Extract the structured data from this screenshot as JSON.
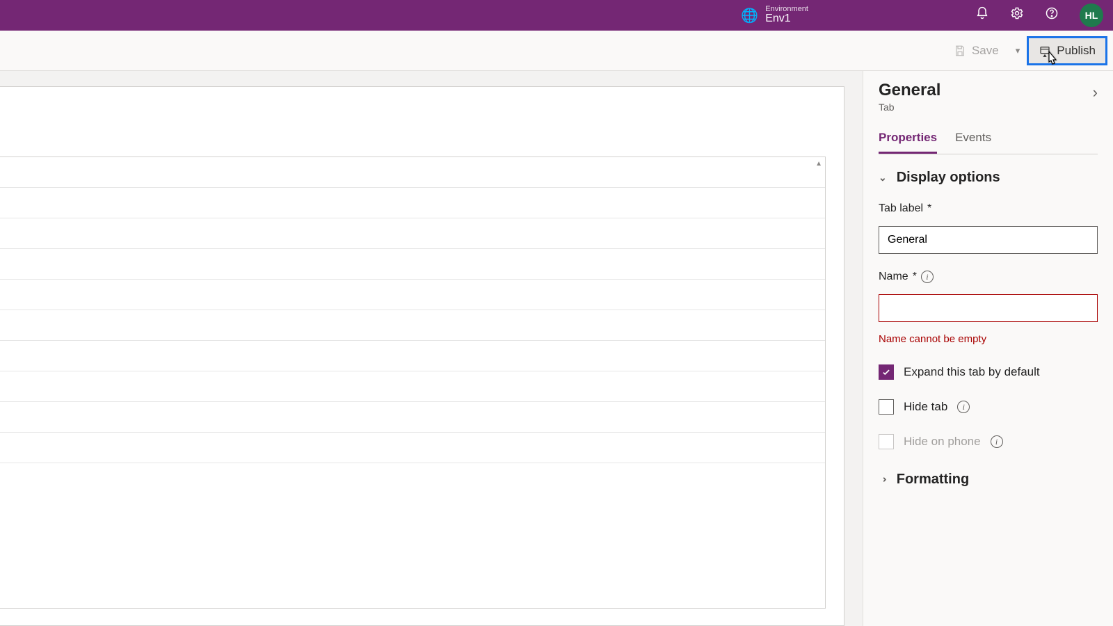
{
  "header": {
    "env_label": "Environment",
    "env_name": "Env1",
    "avatar": "HL"
  },
  "commands": {
    "save": "Save",
    "publish": "Publish"
  },
  "panel": {
    "title": "General",
    "subtitle": "Tab",
    "tabs": {
      "properties": "Properties",
      "events": "Events"
    },
    "sections": {
      "display_options": "Display options",
      "formatting": "Formatting"
    },
    "fields": {
      "tab_label_label": "Tab label",
      "tab_label_value": "General",
      "name_label": "Name",
      "name_value": "",
      "name_error": "Name cannot be empty",
      "expand_label": "Expand this tab by default",
      "hide_tab_label": "Hide tab",
      "hide_phone_label": "Hide on phone"
    }
  }
}
